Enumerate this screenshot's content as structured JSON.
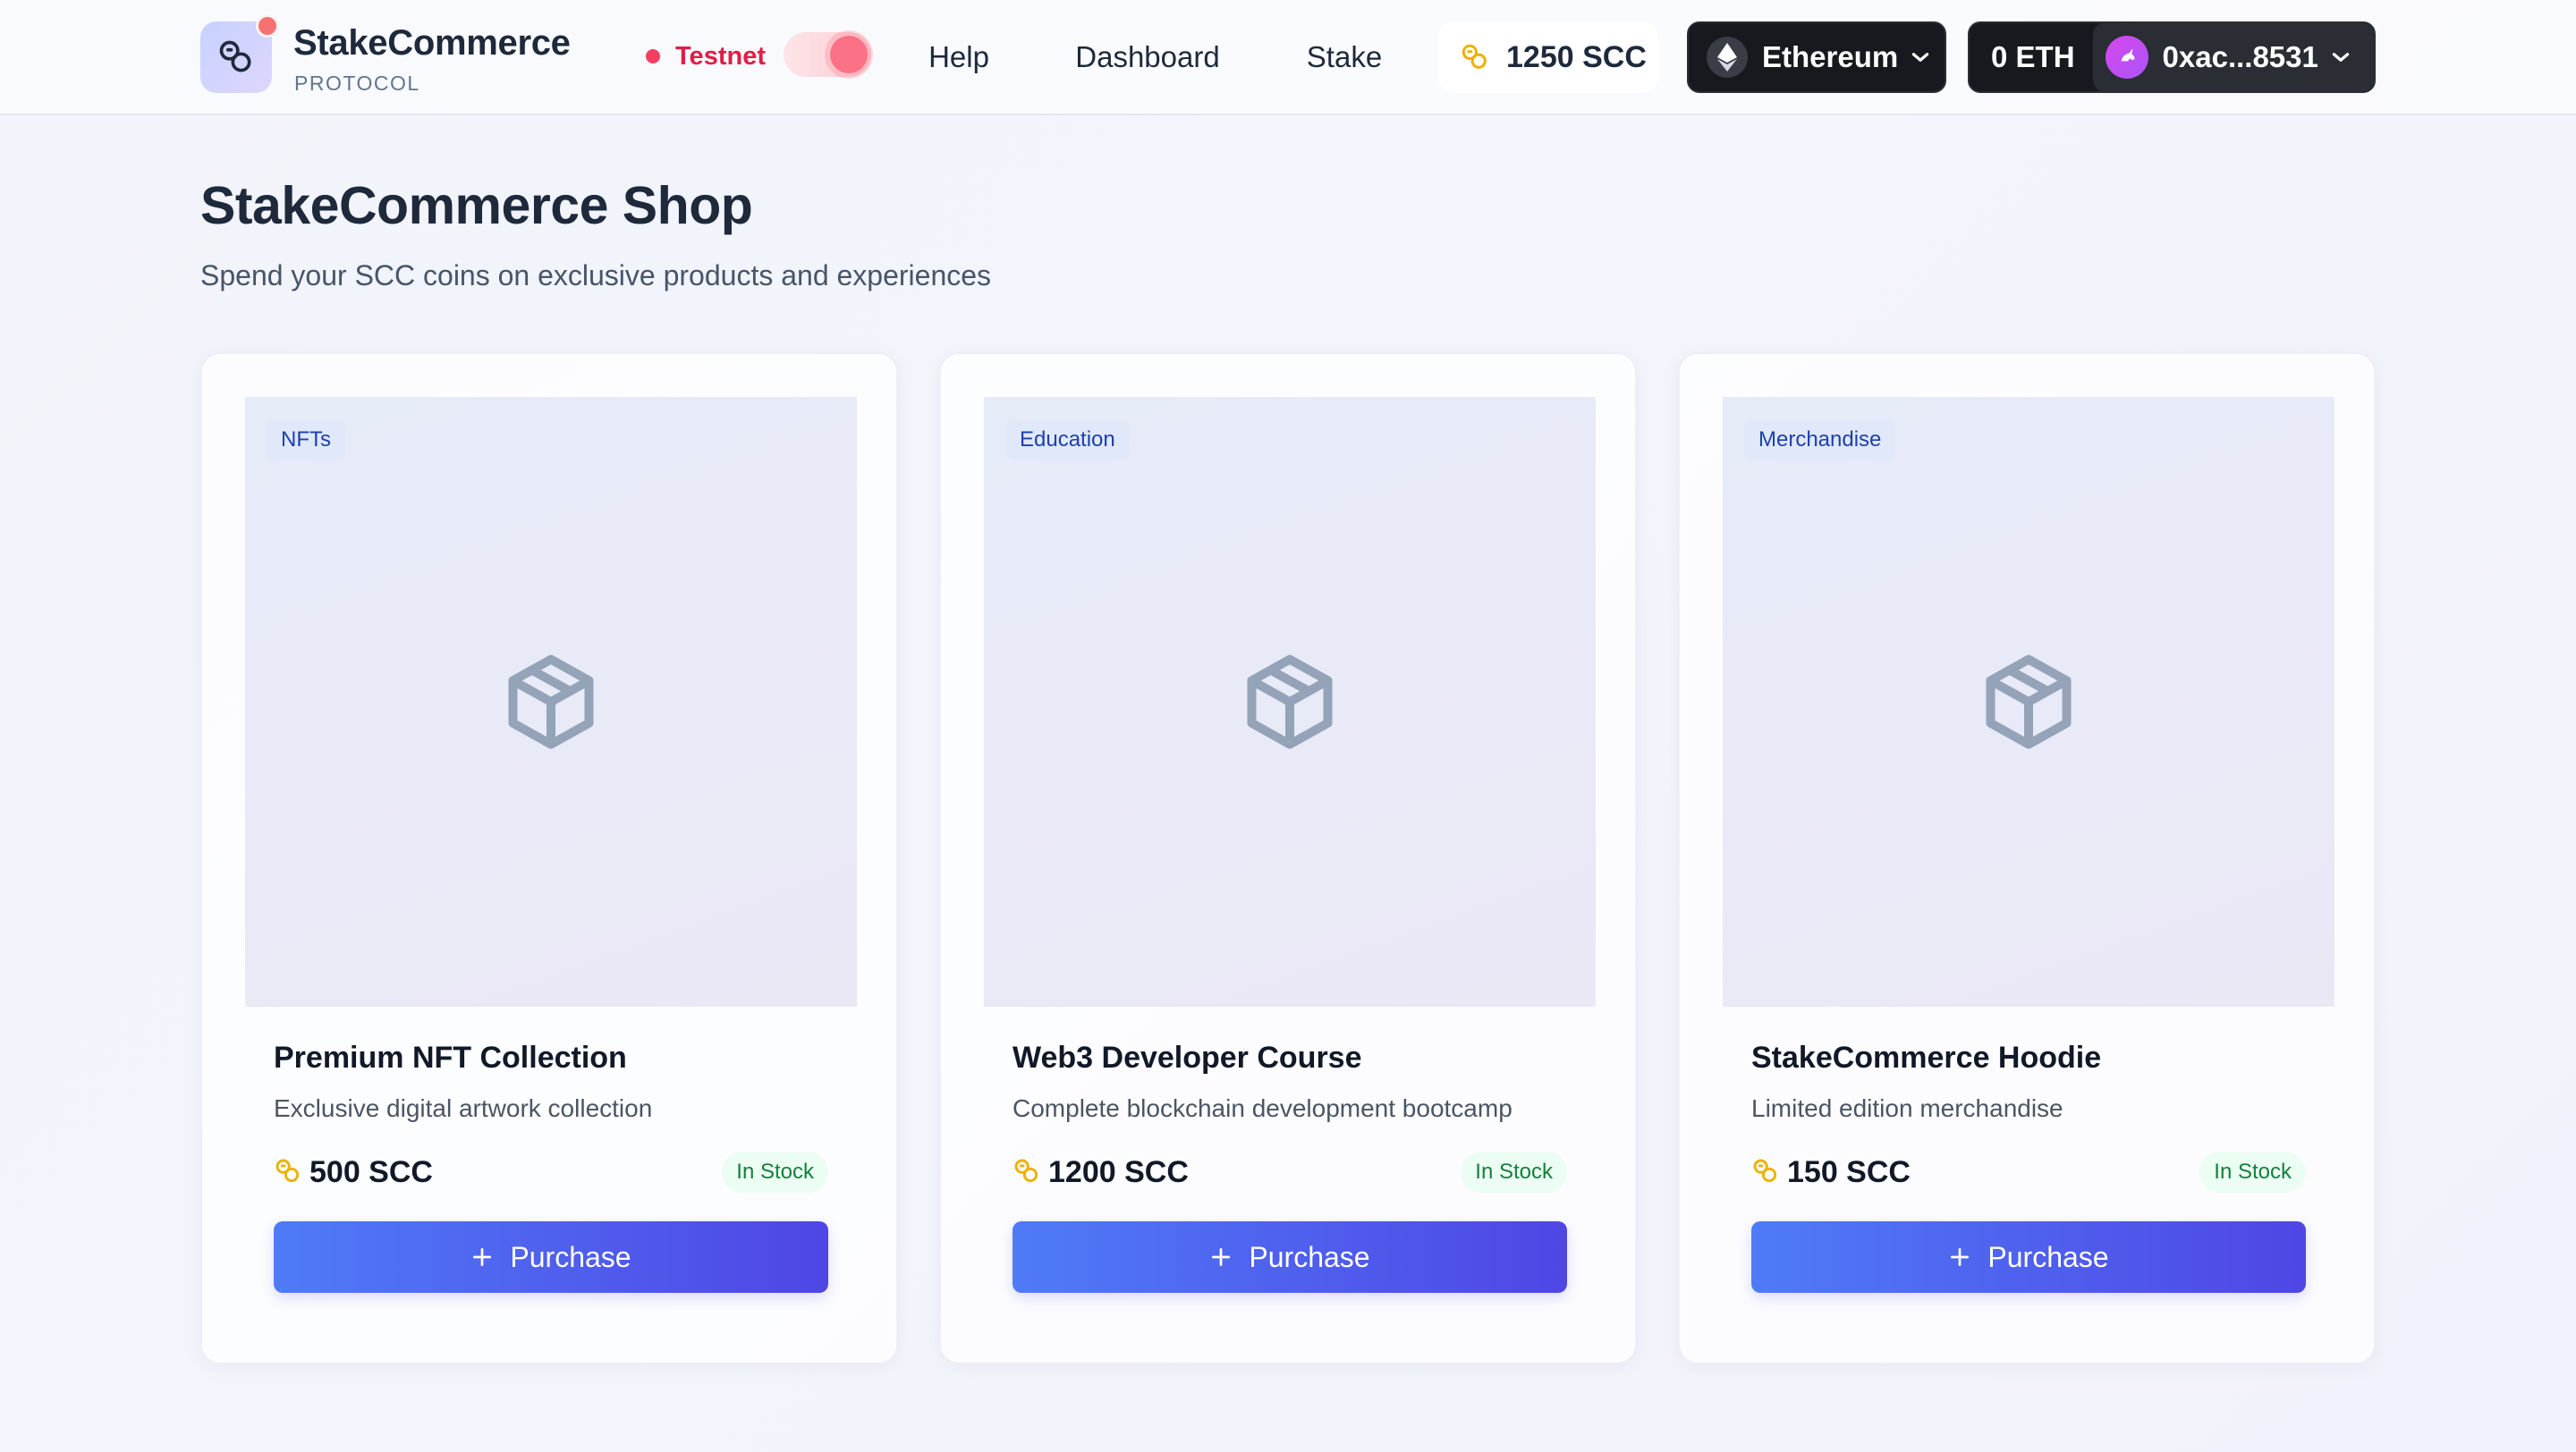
{
  "brand": {
    "name": "StakeCommerce",
    "subtitle": "PROTOCOL"
  },
  "network": {
    "label": "Testnet",
    "toggle_on": true
  },
  "nav": {
    "help": "Help",
    "dashboard": "Dashboard",
    "stake": "Stake"
  },
  "balance": {
    "amount": "1250 SCC",
    "icon": "coin-icon"
  },
  "chain": {
    "label": "Ethereum",
    "icon": "ethereum-icon"
  },
  "wallet": {
    "eth_balance": "0 ETH",
    "address": "0xac...8531"
  },
  "page": {
    "title": "StakeCommerce Shop",
    "subtitle": "Spend your SCC coins on exclusive products and experiences"
  },
  "products": [
    {
      "category": "NFTs",
      "title": "Premium NFT Collection",
      "description": "Exclusive digital artwork collection",
      "price": "500 SCC",
      "stock": "In Stock",
      "button": "Purchase"
    },
    {
      "category": "Education",
      "title": "Web3 Developer Course",
      "description": "Complete blockchain development bootcamp",
      "price": "1200 SCC",
      "stock": "In Stock",
      "button": "Purchase"
    },
    {
      "category": "Merchandise",
      "title": "StakeCommerce Hoodie",
      "description": "Limited edition merchandise",
      "price": "150 SCC",
      "stock": "In Stock",
      "button": "Purchase"
    }
  ],
  "colors": {
    "accent_start": "#4f7bf7",
    "accent_end": "#4f46e5",
    "testnet": "#e11d48",
    "in_stock": "#15803d",
    "coin": "#eab308"
  }
}
